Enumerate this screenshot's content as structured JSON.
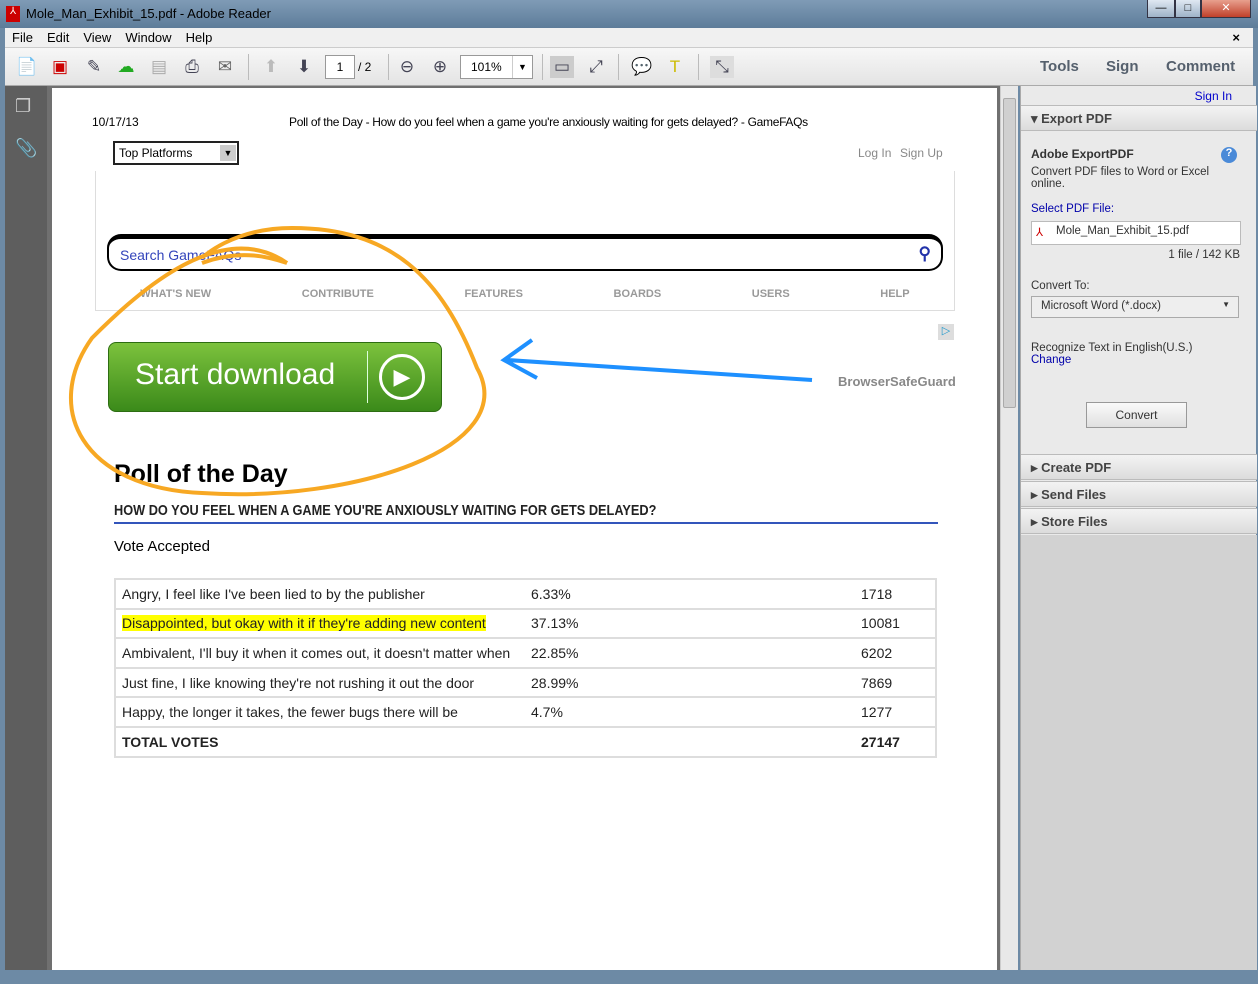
{
  "window": {
    "title": "Mole_Man_Exhibit_15.pdf - Adobe Reader",
    "min": "—",
    "max": "□",
    "close": "✕"
  },
  "menu": [
    "File",
    "Edit",
    "View",
    "Window",
    "Help"
  ],
  "toolbar": {
    "page_current": "1",
    "page_total": "/ 2",
    "zoom": "101%",
    "tools": "Tools",
    "sign": "Sign",
    "comment": "Comment"
  },
  "pdf": {
    "date": "10/17/13",
    "header_title": "Poll of the Day - How do you feel when a game you're anxiously waiting for gets delayed? - GameFAQs",
    "platforms_select": "Top Platforms",
    "login": "Log In",
    "signup": "Sign Up",
    "search_placeholder": "Search GameFAQs",
    "nav": [
      "WHAT'S NEW",
      "CONTRIBUTE",
      "FEATURES",
      "BOARDS",
      "USERS",
      "HELP"
    ],
    "ad": {
      "button": "Start download",
      "brand": "BrowserSafeGuard"
    },
    "poll_heading": "Poll of the Day",
    "question": "HOW DO YOU FEEL WHEN A GAME YOU'RE ANXIOUSLY WAITING FOR GETS DELAYED?",
    "status": "Vote Accepted",
    "rows": [
      {
        "answer": "Angry, I feel like I've been lied to by the publisher",
        "percent": "6.33%",
        "votes": "1718"
      },
      {
        "answer": "Disappointed, but okay with it if they're adding new content",
        "percent": "37.13%",
        "votes": "10081",
        "highlighted": true
      },
      {
        "answer": "Ambivalent, I'll buy it when it comes out, it doesn't matter when",
        "percent": "22.85%",
        "votes": "6202"
      },
      {
        "answer": "Just fine, I like knowing they're not rushing it out the door",
        "percent": "28.99%",
        "votes": "7869"
      },
      {
        "answer": "Happy, the longer it takes, the fewer bugs there will be",
        "percent": "4.7%",
        "votes": "1277"
      }
    ],
    "total_label": "TOTAL VOTES",
    "total_votes": "27147"
  },
  "panel": {
    "sign_in": "Sign In",
    "export": "Export PDF",
    "title": "Adobe ExportPDF",
    "desc": "Convert PDF files to Word or Excel online.",
    "select_label": "Select PDF File:",
    "file": "Mole_Man_Exhibit_15.pdf",
    "file_info": "1 file / 142 KB",
    "convert_to": "Convert To:",
    "format": "Microsoft Word (*.docx)",
    "recognize": "Recognize Text in English(U.S.)",
    "change": "Change",
    "convert": "Convert",
    "sections": [
      "Create PDF",
      "Send Files",
      "Store Files"
    ]
  },
  "colors": {
    "annotation_circle": "#f7a823",
    "annotation_arrow": "#1e90ff",
    "highlight": "#ffff00",
    "link": "#0000cc"
  }
}
